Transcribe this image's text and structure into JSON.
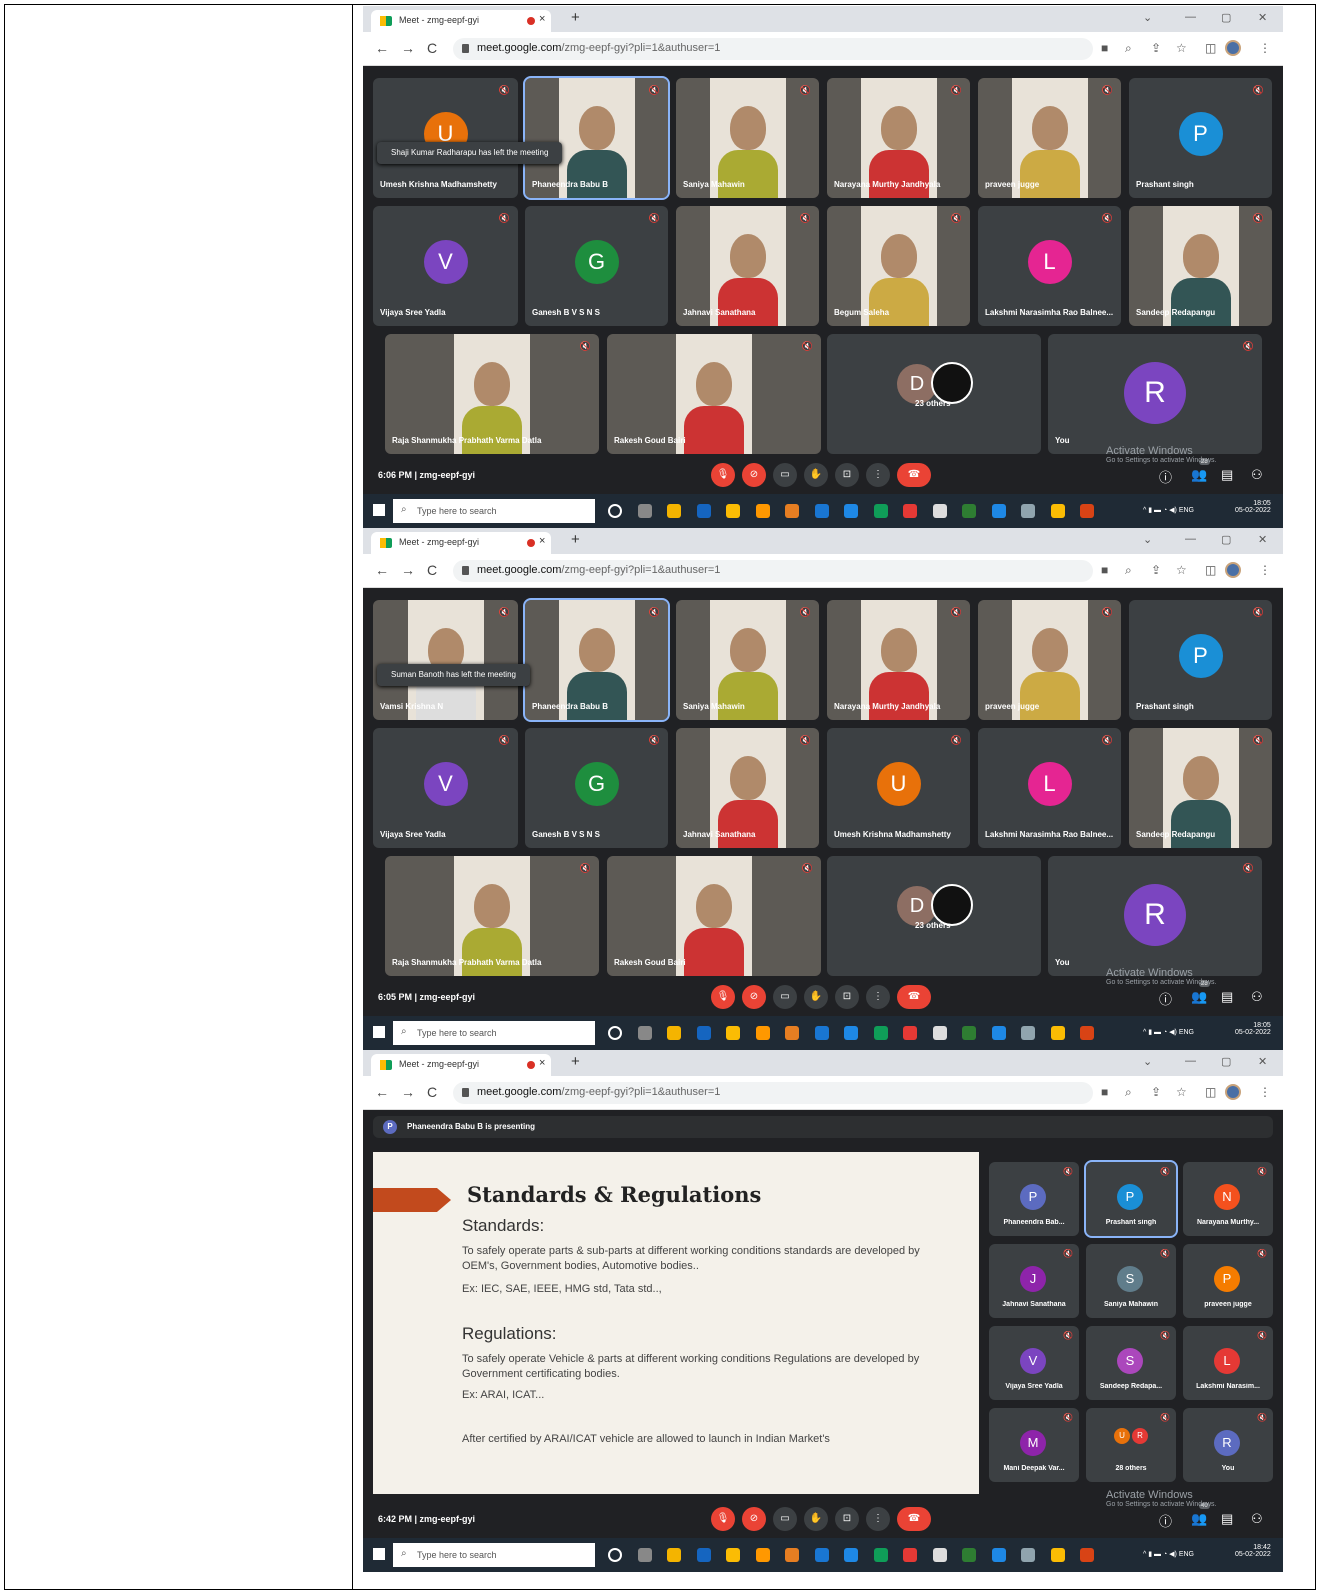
{
  "tab": {
    "title": "Meet - zmg-eepf-gyi",
    "close": "×",
    "new": "+"
  },
  "window": {
    "min": "—",
    "restore": "▢",
    "close": "✕",
    "chev": "⌄"
  },
  "nav": {
    "back": "←",
    "fwd": "→",
    "reload": "C"
  },
  "url": {
    "host": "meet.google.com",
    "path": "/zmg-eepf-gyi?pli=1&authuser=1"
  },
  "meeting_code": "zmg-eepf-gyi",
  "taskbar": {
    "search": "Type here to search",
    "lang": "ENG"
  },
  "activate": {
    "title": "Activate Windows",
    "sub": "Go to Settings to activate Windows."
  },
  "others": "23 others",
  "you": "You",
  "shot1": {
    "time": "6:06 PM",
    "tray_time": "18:05",
    "date": "05-02-2022",
    "badge": "28",
    "notice": "Shaji Kumar Radharapu has left the meeting",
    "tiles": [
      {
        "name": "Umesh Krishna Madhamshetty",
        "letter": "U",
        "color": "#e8710a"
      },
      {
        "name": "Phaneendra Babu B"
      },
      {
        "name": "Saniya Mahawin"
      },
      {
        "name": "Narayana Murthy Jandhyala"
      },
      {
        "name": "praveen jugge"
      },
      {
        "name": "Prashant singh",
        "letter": "P",
        "color": "#1a8fd6"
      },
      {
        "name": "Vijaya Sree Yadla",
        "letter": "V",
        "color": "#7b45c0"
      },
      {
        "name": "Ganesh B V S N S",
        "letter": "G",
        "color": "#1e8e3e"
      },
      {
        "name": "Jahnavi Sanathana"
      },
      {
        "name": "Begum Saleha"
      },
      {
        "name": "Lakshmi Narasimha Rao Balnee...",
        "letter": "L",
        "color": "#e52592"
      },
      {
        "name": "Sandeep Redapangu"
      },
      {
        "name": "Raja Shanmukha Prabhath Varma Datla"
      },
      {
        "name": "Rakesh Goud Bairi"
      }
    ]
  },
  "shot2": {
    "time": "6:05 PM",
    "tray_time": "18:05",
    "date": "05-02-2022",
    "badge": "28",
    "notice": "Suman Banoth has left the meeting",
    "tiles": [
      {
        "name": "Vamsi Krishna N"
      },
      {
        "name": "Phaneendra Babu B"
      },
      {
        "name": "Saniya Mahawin"
      },
      {
        "name": "Narayana Murthy Jandhyala"
      },
      {
        "name": "praveen jugge"
      },
      {
        "name": "Prashant singh",
        "letter": "P",
        "color": "#1a8fd6"
      },
      {
        "name": "Vijaya Sree Yadla",
        "letter": "V",
        "color": "#7b45c0"
      },
      {
        "name": "Ganesh B V S N S",
        "letter": "G",
        "color": "#1e8e3e"
      },
      {
        "name": "Jahnavi Sanathana"
      },
      {
        "name": "Umesh Krishna Madhamshetty",
        "letter": "U",
        "color": "#e8710a"
      },
      {
        "name": "Lakshmi Narasimha Rao Balnee...",
        "letter": "L",
        "color": "#e52592"
      },
      {
        "name": "Sandeep Redapangu"
      },
      {
        "name": "Raja Shanmukha Prabhath Varma Datla"
      },
      {
        "name": "Rakesh Goud Bairi"
      }
    ]
  },
  "shot3": {
    "time": "6:42 PM",
    "tray_time": "18:42",
    "date": "05-02-2022",
    "badge": "40",
    "presenting": "Phaneendra Babu B is presenting",
    "presenter_letter": "P",
    "slide": {
      "title": "Standards & Regulations",
      "h1": "Standards:",
      "p1": "To safely operate parts & sub-parts at different working conditions standards are developed by OEM's, Government bodies, Automotive bodies..",
      "e1": "Ex: IEC, SAE, IEEE, HMG std, Tata std..,",
      "h2": "Regulations:",
      "p2": "To safely operate Vehicle & parts at different working conditions Regulations are developed by Government certificating bodies.",
      "e2": "Ex: ARAI, ICAT...",
      "p3": "After certified by ARAI/ICAT vehicle are allowed to launch in Indian Market's"
    },
    "people": [
      {
        "name": "Phaneendra Bab...",
        "letter": "P",
        "color": "#5c6bc0"
      },
      {
        "name": "Prashant singh",
        "letter": "P",
        "color": "#1a8fd6"
      },
      {
        "name": "Narayana Murthy...",
        "letter": "N",
        "color": "#f4511e"
      },
      {
        "name": "Jahnavi Sanathana",
        "letter": "J",
        "color": "#8e24aa"
      },
      {
        "name": "Saniya Mahawin",
        "letter": "S",
        "color": "#607d8b"
      },
      {
        "name": "praveen jugge",
        "letter": "P",
        "color": "#f57c00"
      },
      {
        "name": "Vijaya Sree Yadla",
        "letter": "V",
        "color": "#7b45c0"
      },
      {
        "name": "Sandeep Redapa...",
        "letter": "S",
        "color": "#ab47bc"
      },
      {
        "name": "Lakshmi Narasim...",
        "letter": "L",
        "color": "#e53935"
      },
      {
        "name": "Mani Deepak Var...",
        "letter": "M",
        "color": "#8e24aa"
      },
      {
        "name": "28 others",
        "letter": "U",
        "color": "#e8710a",
        "letter2": "R"
      },
      {
        "name": "You",
        "letter": "R",
        "color": "#5c6bc0"
      }
    ]
  },
  "icons": {
    "mic_off": "mic-off-icon",
    "cam_off": "camera-off-icon",
    "cc": "captions-icon",
    "hand": "raise-hand-icon",
    "present": "present-icon",
    "more": "more-icon",
    "hangup": "hangup-icon"
  }
}
